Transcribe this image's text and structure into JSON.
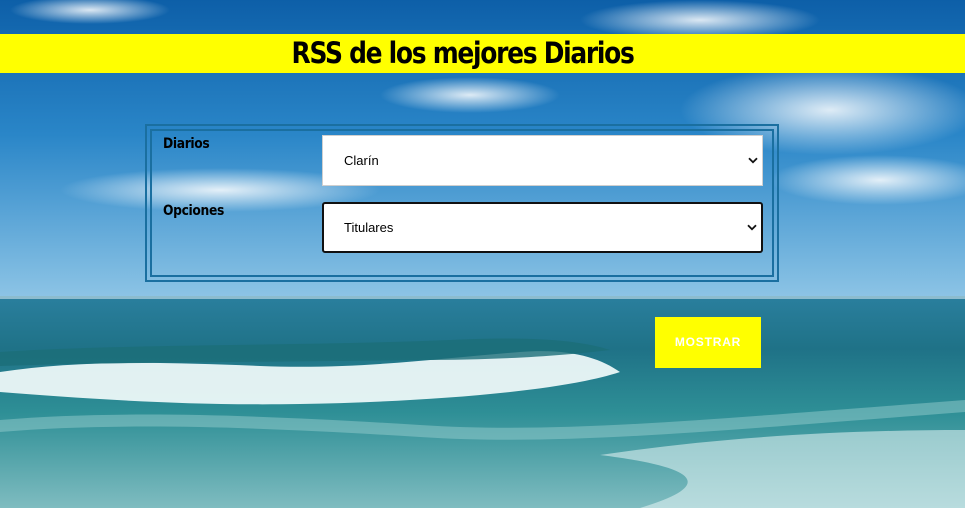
{
  "header": {
    "title": "RSS de los mejores Diarios"
  },
  "form": {
    "diarios_label": "Diarios",
    "diarios_value": "Clarín",
    "opciones_label": "Opciones",
    "opciones_value": "Titulares"
  },
  "actions": {
    "mostrar_label": "MOSTRAR"
  },
  "colors": {
    "header_bar": "#ffff00",
    "button_bg": "#ffff00",
    "frame_border": "#1a6fa0"
  },
  "icons": {
    "select_arrow": "chevron-down-icon"
  }
}
